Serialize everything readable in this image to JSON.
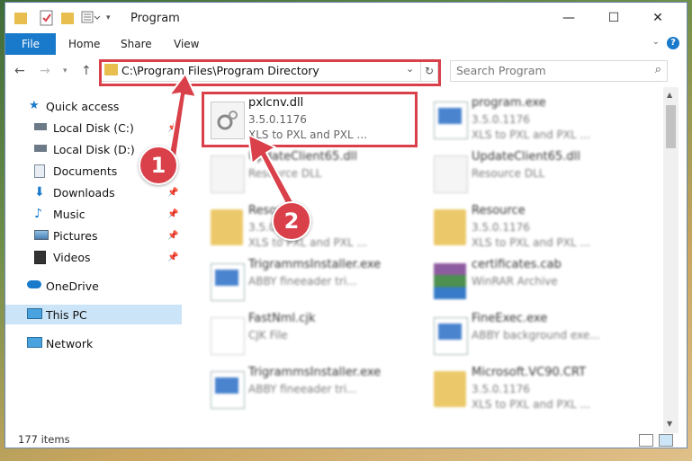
{
  "window": {
    "title": "Program"
  },
  "ribbon": {
    "file_tab": "File",
    "tabs": [
      "Home",
      "Share",
      "View"
    ],
    "help_glyph": "?"
  },
  "navigation": {
    "address": "C:\\Program Files\\Program Directory",
    "search_placeholder": "Search Program"
  },
  "sidebar": {
    "items": [
      {
        "label": "Quick access",
        "icon": "star-icon"
      },
      {
        "label": "Local Disk (C:)",
        "icon": "drive-icon"
      },
      {
        "label": "Local Disk (D:)",
        "icon": "drive-icon"
      },
      {
        "label": "Documents",
        "icon": "documents-icon"
      },
      {
        "label": "Downloads",
        "icon": "download-icon"
      },
      {
        "label": "Music",
        "icon": "music-icon"
      },
      {
        "label": "Pictures",
        "icon": "pictures-icon"
      },
      {
        "label": "Videos",
        "icon": "videos-icon"
      },
      {
        "label": "OneDrive",
        "icon": "cloud-icon"
      },
      {
        "label": "This PC",
        "icon": "pc-icon"
      },
      {
        "label": "Network",
        "icon": "network-icon"
      }
    ]
  },
  "files": [
    {
      "name": "pxlcnv.dll",
      "line2": "3.5.0.1176",
      "line3": "XLS to PXL and PXL ...",
      "icon": "gear-dll-icon"
    },
    {
      "name": "program.exe",
      "line2": "3.5.0.1176",
      "line3": "XLS to PXL and PXL ...",
      "icon": "exe-icon"
    },
    {
      "name": "UpdateClient65.dll",
      "line2": "Resource DLL",
      "line3": "",
      "icon": "gear-dll-icon"
    },
    {
      "name": "UpdateClient65.dll",
      "line2": "Resource DLL",
      "line3": "",
      "icon": "gear-dll-icon"
    },
    {
      "name": "Resource",
      "line2": "3.5.0.1176",
      "line3": "XLS to PXL and PXL ...",
      "icon": "folder-icon"
    },
    {
      "name": "Resource",
      "line2": "3.5.0.1176",
      "line3": "XLS to PXL and PXL ...",
      "icon": "folder-icon"
    },
    {
      "name": "TrigrammsInstaller.exe",
      "line2": "ABBY fineeader tri...",
      "line3": "",
      "icon": "exe-icon"
    },
    {
      "name": "certificates.cab",
      "line2": "WinRAR Archive",
      "line3": "",
      "icon": "rar-icon"
    },
    {
      "name": "FastNml.cjk",
      "line2": "CJK File",
      "line3": "",
      "icon": "file-icon"
    },
    {
      "name": "FineExec.exe",
      "line2": "ABBY background exe...",
      "line3": "",
      "icon": "exe-icon"
    },
    {
      "name": "TrigrammsInstaller.exe",
      "line2": "ABBY fineeader tri...",
      "line3": "",
      "icon": "exe-icon"
    },
    {
      "name": "Microsoft.VC90.CRT",
      "line2": "3.5.0.1176",
      "line3": "XLS to PXL and PXL ...",
      "icon": "folder-icon"
    }
  ],
  "status": {
    "count": "177 items"
  },
  "callouts": [
    "1",
    "2"
  ],
  "colors": {
    "accent": "#1979ca",
    "highlight": "#d9404a",
    "selection": "#cce4f7"
  }
}
